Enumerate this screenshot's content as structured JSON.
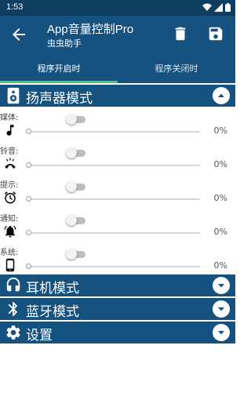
{
  "status_bar": {
    "time": "1:53"
  },
  "toolbar": {
    "title": "App音量控制Pro",
    "subtitle": "虫虫助手"
  },
  "tabs": [
    {
      "label": "程序开启时",
      "active": true
    },
    {
      "label": "程序关闭时",
      "active": false
    }
  ],
  "sections": {
    "speaker": {
      "title": "扬声器模式",
      "expanded": true
    },
    "headphone": {
      "title": "耳机模式",
      "expanded": false
    },
    "bluetooth": {
      "title": "蓝牙模式",
      "expanded": false
    },
    "settings": {
      "title": "设置",
      "expanded": false
    }
  },
  "rows": [
    {
      "label": "媒体:",
      "icon": "music-note-icon",
      "enabled": false,
      "level": 0,
      "percent": "0%"
    },
    {
      "label": "铃音:",
      "icon": "phone-ring-icon",
      "enabled": false,
      "level": 0,
      "percent": "0%"
    },
    {
      "label": "提示:",
      "icon": "alarm-clock-icon",
      "enabled": false,
      "level": 0,
      "percent": "0%"
    },
    {
      "label": "通知:",
      "icon": "bell-icon",
      "enabled": false,
      "level": 0,
      "percent": "0%"
    },
    {
      "label": "系统:",
      "icon": "phone-device-icon",
      "enabled": false,
      "level": 0,
      "percent": "0%"
    }
  ],
  "colors": {
    "primary": "#16527f",
    "status_bar": "#0f3d5f",
    "tab_indicator": "#4cc865"
  }
}
